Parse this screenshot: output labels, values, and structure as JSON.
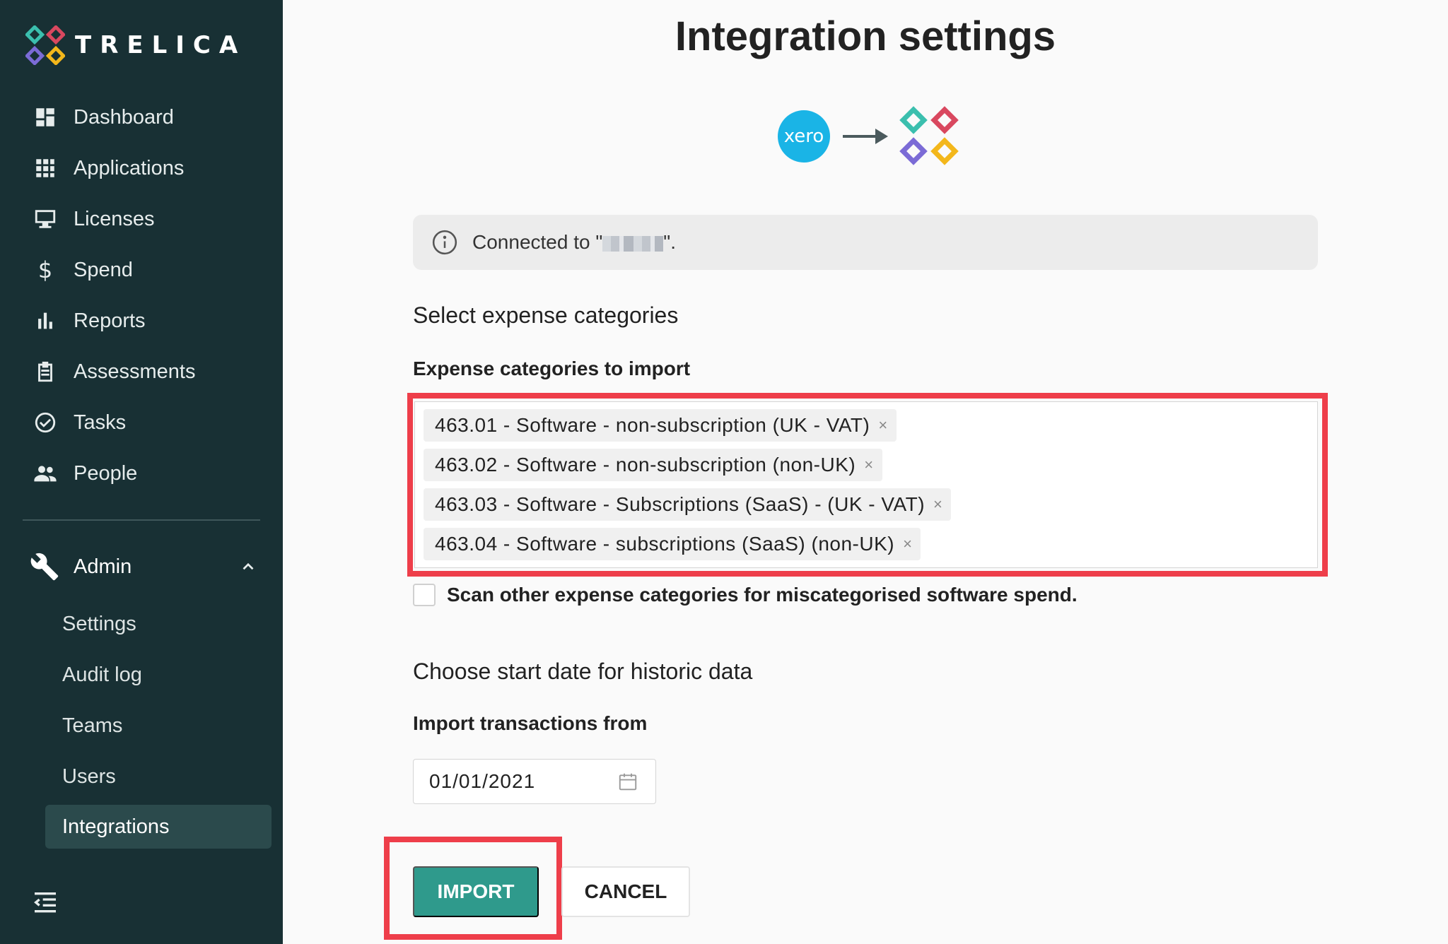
{
  "brand": {
    "name": "TRELICA"
  },
  "sidebar": {
    "items": [
      {
        "label": "Dashboard",
        "icon": "dashboard-icon"
      },
      {
        "label": "Applications",
        "icon": "apps-grid-icon"
      },
      {
        "label": "Licenses",
        "icon": "licenses-icon"
      },
      {
        "label": "Spend",
        "icon": "dollar-icon"
      },
      {
        "label": "Reports",
        "icon": "bar-chart-icon"
      },
      {
        "label": "Assessments",
        "icon": "clipboard-icon"
      },
      {
        "label": "Tasks",
        "icon": "check-circle-icon"
      },
      {
        "label": "People",
        "icon": "people-icon"
      }
    ],
    "admin": {
      "label": "Admin",
      "expanded": true,
      "sub_items": [
        {
          "label": "Settings"
        },
        {
          "label": "Audit log"
        },
        {
          "label": "Teams"
        },
        {
          "label": "Users"
        },
        {
          "label": "Integrations",
          "active": true
        }
      ]
    }
  },
  "main": {
    "title": "Integration settings",
    "source_logo_text": "xero",
    "info": {
      "prefix": "Connected to \"",
      "suffix": "\"."
    },
    "expense": {
      "section_title": "Select expense categories",
      "field_label": "Expense categories to import",
      "tags": [
        "463.01 - Software - non-subscription (UK - VAT)",
        "463.02 - Software - non-subscription (non-UK)",
        "463.03 - Software - Subscriptions (SaaS) - (UK - VAT)",
        "463.04 - Software - subscriptions (SaaS) (non-UK)"
      ],
      "remove_glyph": "×",
      "scan_label": "Scan other expense categories for miscategorised software spend.",
      "scan_checked": false
    },
    "history": {
      "section_title": "Choose start date for historic data",
      "field_label": "Import transactions from",
      "date_value": "01/01/2021"
    },
    "buttons": {
      "import": "IMPORT",
      "cancel": "CANCEL"
    }
  },
  "colors": {
    "sidebar_bg": "#183034",
    "active_item_bg": "#2b4a4c",
    "primary_button": "#2f9a8c",
    "highlight_red": "#ee3e4a",
    "xero_blue": "#1ab4e6"
  }
}
